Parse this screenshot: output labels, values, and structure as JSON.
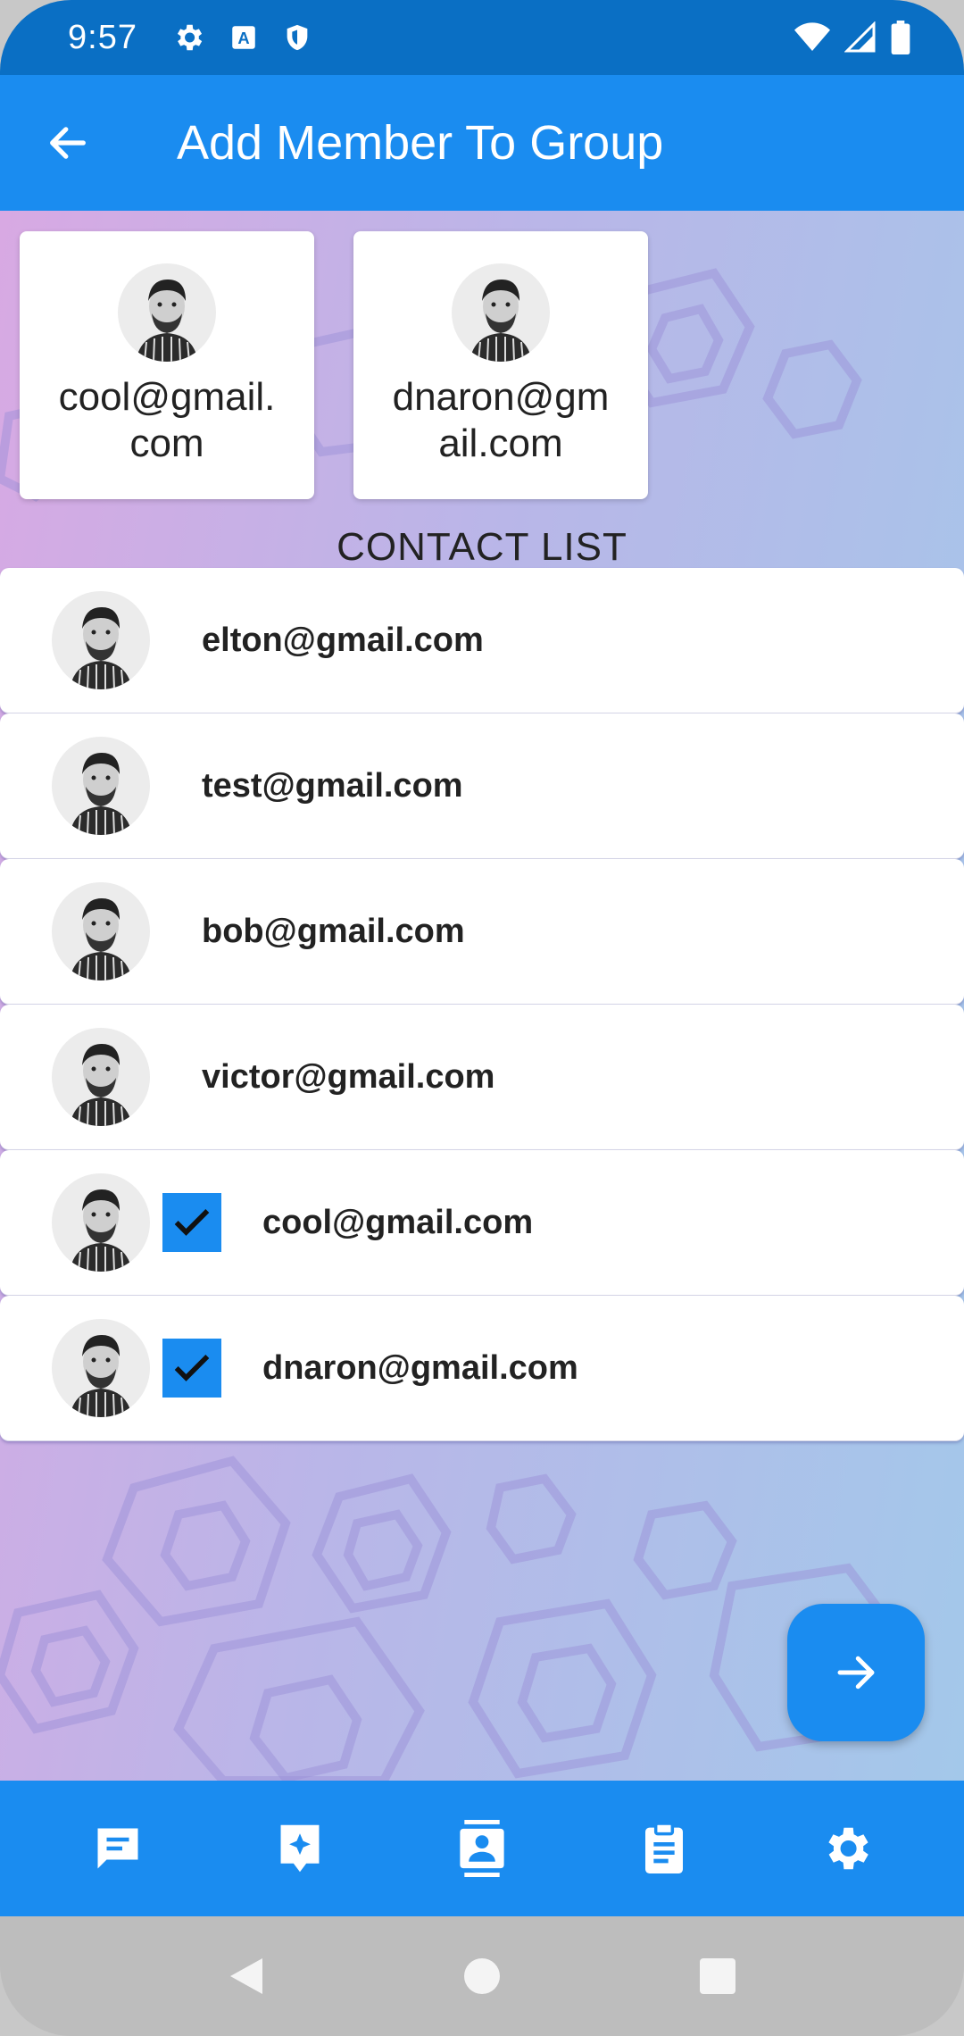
{
  "status_bar": {
    "time": "9:57",
    "icons": [
      "gear-icon",
      "a-icon",
      "shield-icon",
      "wifi-icon",
      "signal-icon",
      "battery-icon"
    ]
  },
  "app_bar": {
    "title": "Add Member To Group",
    "back_icon": "arrow-left-icon"
  },
  "selected_members": [
    {
      "email": "cool@gmail.com"
    },
    {
      "email": "dnaron@gmail.com"
    }
  ],
  "contact_list": {
    "heading": "CONTACT LIST",
    "items": [
      {
        "email": "elton@gmail.com",
        "checked": false
      },
      {
        "email": "test@gmail.com",
        "checked": false
      },
      {
        "email": "bob@gmail.com",
        "checked": false
      },
      {
        "email": "victor@gmail.com",
        "checked": false
      },
      {
        "email": "cool@gmail.com",
        "checked": true
      },
      {
        "email": "dnaron@gmail.com",
        "checked": true
      }
    ]
  },
  "fab": {
    "icon": "arrow-right-icon"
  },
  "bottom_nav": {
    "items": [
      "chat-icon",
      "star-chat-icon",
      "contacts-icon",
      "clipboard-icon",
      "settings-icon"
    ]
  },
  "system_nav": [
    "back-triangle-icon",
    "home-circle-icon",
    "recents-square-icon"
  ],
  "colors": {
    "primary": "#1a8cf0",
    "status_bar": "#0a6fc4"
  }
}
